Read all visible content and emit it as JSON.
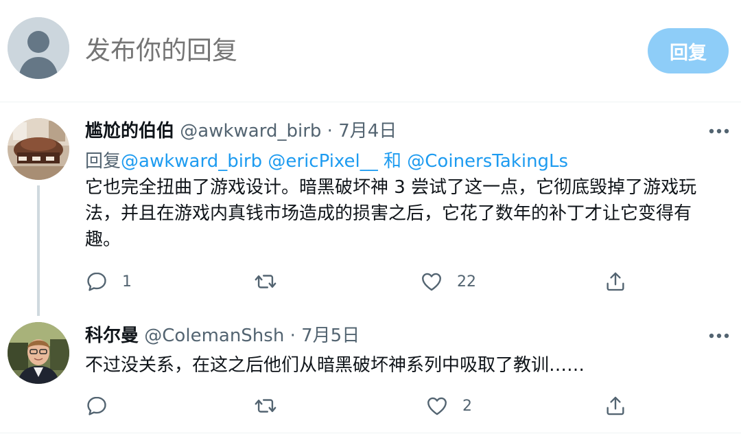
{
  "compose": {
    "placeholder": "发布你的回复",
    "reply_button": "回复"
  },
  "tweets": [
    {
      "name": "尴尬的伯伯",
      "handle": "@awkward_birb",
      "separator": "·",
      "date": "7月4日",
      "replying_prefix": "回复",
      "replying_mention1": "@awkward_birb",
      "replying_mention2": "@ericPixel__",
      "replying_and": "和",
      "replying_mention3": "@CoinersTakingLs",
      "text": "它也完全扭曲了游戏设计。暗黑破坏神 3 尝试了这一点，它彻底毁掉了游戏玩法，并且在游戏内真钱市场造成的损害之后，它花了数年的补丁才让它变得有趣。",
      "reply_count": "1",
      "retweet_count": "",
      "like_count": "22"
    },
    {
      "name": "科尔曼",
      "handle": "@ColemanShsh",
      "separator": "·",
      "date": "7月5日",
      "text": "不过没关系，在这之后他们从暗黑破坏神系列中吸取了教训……",
      "reply_count": "",
      "retweet_count": "",
      "like_count": "2"
    }
  ],
  "colors": {
    "accent": "#1d9bf0",
    "reply_button_disabled": "#8ecdf8",
    "secondary_text": "#536471",
    "divider": "#eff3f4"
  },
  "icons": [
    "default-avatar-icon",
    "more-icon",
    "reply-icon",
    "retweet-icon",
    "like-icon",
    "share-icon"
  ]
}
